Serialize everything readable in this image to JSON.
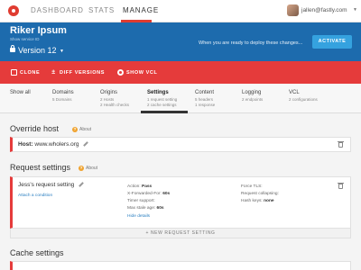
{
  "nav": {
    "tabs": [
      {
        "label": "DASHBOARD"
      },
      {
        "label": "STATS"
      },
      {
        "label": "MANAGE"
      }
    ],
    "user_email": "jallen@fastly.com"
  },
  "service": {
    "name": "Riker Ipsum",
    "show_id_label": "Show service ID",
    "version_label": "Version 12",
    "deploy_message": "When you are ready to deploy these changes...",
    "activate_label": "ACTIVATE"
  },
  "actions": {
    "clone": "CLONE",
    "diff": "DIFF VERSIONS",
    "vcl": "SHOW VCL"
  },
  "config_tabs": [
    {
      "label": "Show all",
      "line1": "",
      "line2": ""
    },
    {
      "label": "Domains",
      "line1": "5 Domains",
      "line2": ""
    },
    {
      "label": "Origins",
      "line1": "2 Hosts",
      "line2": "2 Health checks"
    },
    {
      "label": "Settings",
      "line1": "1 request setting",
      "line2": "2 cache settings"
    },
    {
      "label": "Content",
      "line1": "5 headers",
      "line2": "1 response"
    },
    {
      "label": "Logging",
      "line1": "2 endpoints",
      "line2": ""
    },
    {
      "label": "VCL",
      "line1": "2 configurations",
      "line2": ""
    }
  ],
  "override_host": {
    "title": "Override host",
    "about": "About",
    "host_label": "Host:",
    "host_value": "www.wholers.org"
  },
  "request_settings": {
    "title": "Request settings",
    "about": "About",
    "setting_name": "Jess's request setting",
    "attach_condition": "Attach a condition",
    "action_label": "Action:",
    "action_value": "Pass",
    "xff_label": "X-Forwarded-For:",
    "xff_value": "60s",
    "timer_label": "Timer support:",
    "timer_value": "",
    "stale_label": "Max stale age:",
    "stale_value": "60s",
    "hide_details": "Hide details",
    "force_tls_label": "Force TLS:",
    "force_tls_value": "",
    "collapsing_label": "Request collapsing:",
    "collapsing_value": "",
    "hash_label": "Hash keys:",
    "hash_value": "none",
    "new_button": "+ NEW REQUEST SETTING"
  },
  "cache_settings": {
    "title": "Cache settings"
  },
  "colors": {
    "brand_blue": "#1d6bad",
    "action_red": "#e53b3b",
    "activate_blue": "#35a2df"
  }
}
